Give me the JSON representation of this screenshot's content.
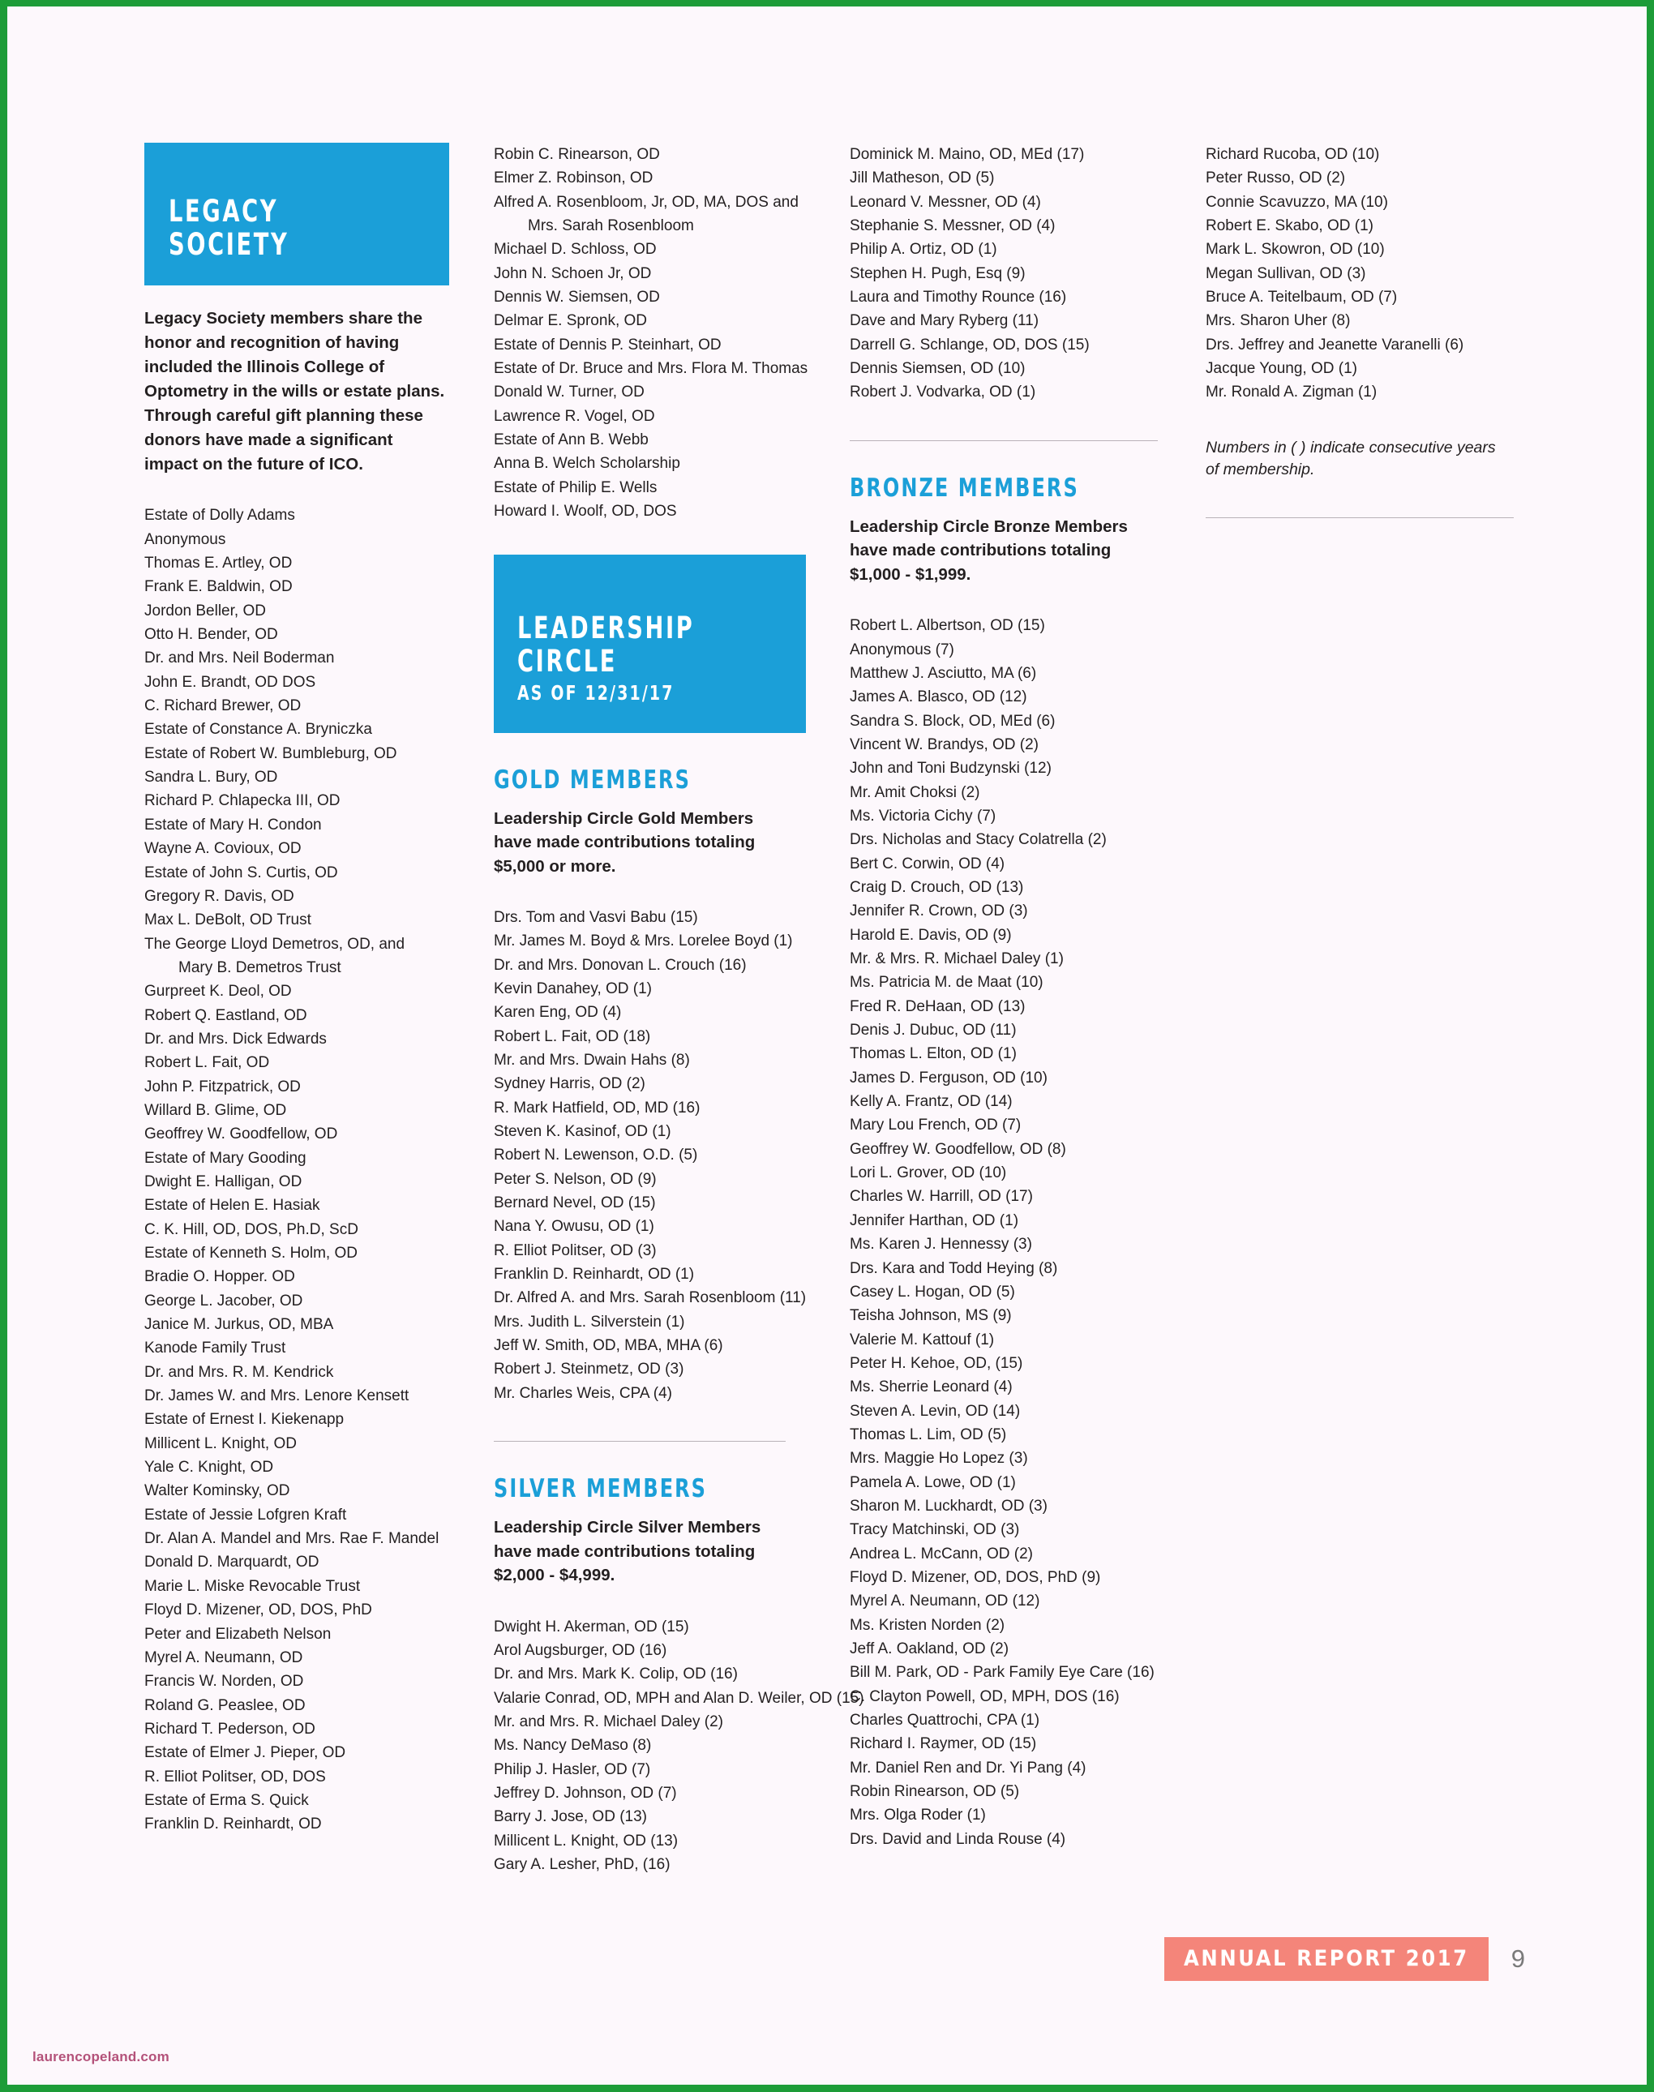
{
  "page": {
    "background_color": "#fdf8fc",
    "border_color": "#1d9c38",
    "accent_blue": "#1b9fd8",
    "accent_coral": "#f4857a"
  },
  "legacy": {
    "hero_line_1": "LEGACY",
    "hero_line_2": "SOCIETY",
    "intro": "Legacy Society members share the honor and recognition of having included the Illinois College of Optometry in the wills or estate plans. Through careful gift planning these donors have made a significant impact on the future of ICO.",
    "donors_col_1": [
      "Estate of Dolly Adams",
      "Anonymous",
      "Thomas E. Artley, OD",
      "Frank E. Baldwin, OD",
      "Jordon Beller, OD",
      "Otto H. Bender, OD",
      "Dr. and Mrs. Neil Boderman",
      "John E. Brandt, OD DOS",
      "C. Richard Brewer, OD",
      "Estate of Constance A. Bryniczka",
      "Estate of Robert W. Bumbleburg, OD",
      "Sandra L. Bury, OD",
      "Richard P. Chlapecka III, OD",
      "Estate of Mary H. Condon",
      "Wayne A. Covioux, OD",
      "Estate of John S. Curtis, OD",
      "Gregory R. Davis, OD",
      "Max L.  DeBolt, OD Trust",
      "The George Lloyd Demetros, OD, and",
      "Mary B. Demetros Trust",
      "Gurpreet K. Deol, OD",
      "Robert Q. Eastland, OD",
      "Dr. and Mrs. Dick Edwards",
      "Robert L. Fait, OD",
      "John P. Fitzpatrick, OD",
      "Willard B. Glime, OD",
      "Geoffrey W. Goodfellow, OD",
      "Estate of Mary Gooding",
      "Dwight E. Halligan, OD",
      "Estate of Helen E. Hasiak",
      "C. K. Hill, OD, DOS, Ph.D, ScD",
      "Estate of Kenneth S. Holm, OD",
      "Bradie O. Hopper. OD",
      "George L. Jacober, OD",
      "Janice M. Jurkus, OD, MBA",
      "Kanode Family Trust",
      "Dr. and Mrs. R. M. Kendrick",
      "Dr. James W. and Mrs. Lenore Kensett",
      "Estate of Ernest I. Kiekenapp",
      "Millicent L. Knight, OD",
      "Yale C. Knight, OD",
      "Walter Kominsky, OD",
      "Estate of Jessie Lofgren Kraft",
      "Dr. Alan A. Mandel and Mrs. Rae F. Mandel",
      "Donald D. Marquardt, OD",
      "Marie L. Miske Revocable Trust",
      "Floyd D. Mizener, OD, DOS, PhD",
      "Peter and Elizabeth Nelson",
      "Myrel A. Neumann, OD",
      "Francis W. Norden, OD",
      "Roland G. Peaslee, OD",
      "Richard T. Pederson, OD",
      "Estate of Elmer J. Pieper, OD",
      "R. Elliot Politser, OD, DOS",
      "Estate of Erma S. Quick",
      "Franklin D. Reinhardt, OD"
    ],
    "donors_col_1_indent_indices": [
      19
    ],
    "donors_col_2": [
      "Robin C. Rinearson, OD",
      "Elmer Z. Robinson, OD",
      "Alfred A. Rosenbloom, Jr, OD, MA, DOS and",
      "Mrs. Sarah Rosenbloom",
      "Michael D. Schloss, OD",
      "John N. Schoen Jr, OD",
      "Dennis W. Siemsen, OD",
      "Delmar E. Spronk, OD",
      "Estate of Dennis P. Steinhart, OD",
      "Estate of Dr. Bruce and Mrs. Flora M.  Thomas",
      "Donald W. Turner, OD",
      "Lawrence R. Vogel, OD",
      "Estate of Ann B. Webb",
      "Anna B. Welch Scholarship",
      "Estate of Philip E. Wells",
      "Howard I. Woolf, OD, DOS"
    ],
    "donors_col_2_indent_indices": [
      3
    ]
  },
  "leadership": {
    "hero_line_1": "LEADERSHIP",
    "hero_line_2": "CIRCLE",
    "hero_sub": "AS OF 12/31/17",
    "gold": {
      "heading": "GOLD MEMBERS",
      "description": "Leadership Circle Gold Members have made contributions totaling $5,000 or more.",
      "members": [
        "Drs. Tom and Vasvi Babu (15)",
        "Mr. James M. Boyd & Mrs. Lorelee Boyd (1)",
        "Dr. and Mrs. Donovan L. Crouch (16)",
        "Kevin Danahey, OD (1)",
        "Karen Eng, OD (4)",
        "Robert L. Fait, OD (18)",
        "Mr. and Mrs. Dwain Hahs (8)",
        "Sydney Harris, OD (2)",
        "R. Mark Hatfield, OD, MD (16)",
        "Steven K. Kasinof, OD (1)",
        "Robert N. Lewenson, O.D. (5)",
        "Peter S. Nelson, OD (9)",
        "Bernard Nevel, OD (15)",
        "Nana Y. Owusu, OD (1)",
        "R. Elliot Politser, OD (3)",
        "Franklin D. Reinhardt, OD (1)",
        "Dr. Alfred A. and Mrs. Sarah Rosenbloom (11)",
        "Mrs. Judith L. Silverstein (1)",
        "Jeff W. Smith, OD, MBA, MHA (6)",
        "Robert J. Steinmetz, OD (3)",
        "Mr. Charles Weis, CPA (4)"
      ]
    },
    "silver": {
      "heading": "SILVER MEMBERS",
      "description": "Leadership Circle Silver Members have made contributions totaling $2,000 - $4,999.",
      "members": [
        "Dwight H. Akerman, OD (15)",
        "Arol Augsburger, OD (16)",
        "Dr. and Mrs. Mark K. Colip, OD (16)",
        "Valarie Conrad, OD, MPH and Alan D. Weiler, OD (15)",
        "Mr. and Mrs. R. Michael Daley (2)",
        "Ms. Nancy DeMaso (8)",
        "Philip J. Hasler, OD (7)",
        "Jeffrey D. Johnson, OD (7)",
        "Barry J. Jose, OD (13)",
        "Millicent L. Knight, OD (13)",
        "Gary A. Lesher, PhD, (16)"
      ],
      "members_continued": [
        "Dominick M. Maino, OD, MEd (17)",
        "Jill Matheson, OD (5)",
        "Leonard V. Messner, OD (4)",
        "Stephanie S. Messner, OD (4)",
        "Philip A. Ortiz, OD (1)",
        "Stephen H. Pugh, Esq (9)",
        "Laura and Timothy Rounce (16)",
        "Dave and Mary Ryberg (11)",
        "Darrell G. Schlange, OD, DOS (15)",
        "Dennis Siemsen, OD (10)",
        "Robert J. Vodvarka, OD (1)"
      ]
    },
    "bronze": {
      "heading": "BRONZE MEMBERS",
      "description": "Leadership Circle Bronze Members have made contributions totaling $1,000 - $1,999.",
      "members": [
        "Robert L. Albertson, OD (15)",
        "Anonymous (7)",
        "Matthew J. Asciutto, MA (6)",
        "James A. Blasco, OD (12)",
        "Sandra S. Block, OD, MEd (6)",
        "Vincent W. Brandys, OD (2)",
        "John and Toni Budzynski (12)",
        "Mr. Amit Choksi (2)",
        "Ms. Victoria Cichy (7)",
        "Drs. Nicholas and Stacy Colatrella (2)",
        "Bert C. Corwin, OD (4)",
        "Craig D. Crouch, OD (13)",
        "Jennifer R. Crown, OD (3)",
        "Harold E. Davis, OD (9)",
        "Mr. & Mrs. R. Michael Daley (1)",
        "Ms. Patricia M. de Maat (10)",
        "Fred R. DeHaan, OD (13)",
        "Denis J. Dubuc, OD (11)",
        "Thomas L. Elton, OD (1)",
        "James D. Ferguson, OD (10)",
        "Kelly A. Frantz, OD (14)",
        "Mary Lou French, OD (7)",
        "Geoffrey W. Goodfellow, OD (8)",
        "Lori L. Grover, OD (10)",
        "Charles W. Harrill, OD (17)",
        "Jennifer Harthan, OD (1)",
        "Ms. Karen J. Hennessy (3)",
        "Drs. Kara and Todd Heying (8)",
        "Casey L. Hogan, OD (5)",
        "Teisha Johnson, MS (9)",
        "Valerie M. Kattouf (1)",
        "Peter H. Kehoe, OD, (15)",
        "Ms. Sherrie Leonard (4)",
        "Steven A. Levin, OD (14)",
        "Thomas L. Lim, OD (5)",
        "Mrs. Maggie Ho Lopez (3)",
        "Pamela A. Lowe, OD (1)",
        "Sharon M. Luckhardt, OD (3)",
        "Tracy Matchinski, OD (3)",
        "Andrea L. McCann, OD (2)",
        "Floyd D. Mizener, OD, DOS, PhD (9)",
        "Myrel A. Neumann, OD (12)",
        "Ms. Kristen Norden (2)",
        "Jeff A. Oakland, OD (2)",
        "Bill M. Park, OD  - Park Family Eye Care (16)",
        "C. Clayton Powell, OD, MPH, DOS (16)",
        "Charles Quattrochi, CPA (1)",
        "Richard I. Raymer, OD (15)",
        "Mr. Daniel Ren and Dr. Yi Pang (4)",
        "Robin Rinearson, OD (5)",
        "Mrs. Olga Roder (1)",
        "Drs. David and Linda Rouse (4)"
      ],
      "members_continued": [
        "Richard Rucoba, OD (10)",
        "Peter Russo, OD (2)",
        "Connie Scavuzzo, MA (10)",
        "Robert E. Skabo, OD (1)",
        "Mark L. Skowron, OD (10)",
        "Megan Sullivan, OD (3)",
        "Bruce A. Teitelbaum, OD (7)",
        "Mrs. Sharon Uher (8)",
        "Drs. Jeffrey and Jeanette Varanelli (6)",
        "Jacque Young, OD (1)",
        "Mr. Ronald A. Zigman (1)"
      ]
    },
    "note": "Numbers in ( ) indicate consecutive years of membership."
  },
  "footer": {
    "badge": "ANNUAL REPORT 2017",
    "page_number": "9"
  },
  "watermark": "laurencopeland.com"
}
